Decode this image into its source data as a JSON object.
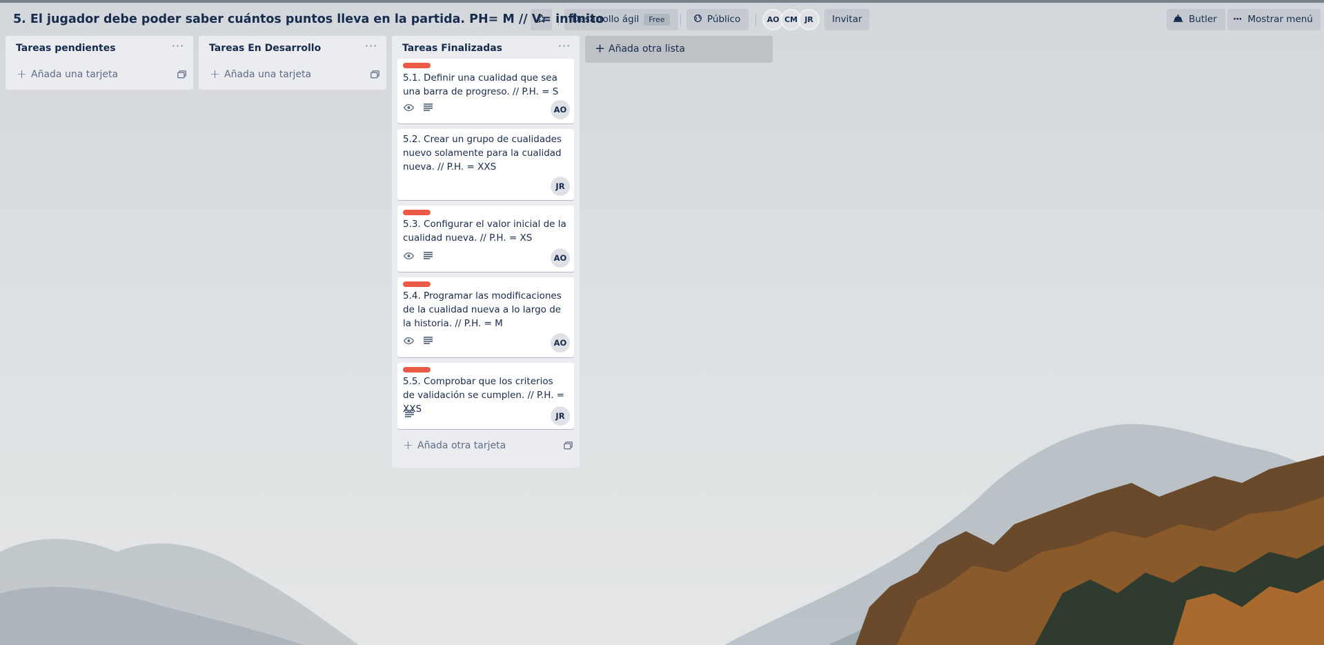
{
  "board": {
    "title": "5. El jugador debe poder saber cuántos puntos lleva en la partida. PH= M // V= infinito",
    "star_icon": "star-icon",
    "workspace": "Desarrollo ágil",
    "workspace_badge": "Free",
    "visibility": "Público",
    "visibility_icon": "globe-icon",
    "members": [
      "AO",
      "CM",
      "JR"
    ],
    "invite_label": "Invitar",
    "butler_label": "Butler",
    "butler_icon": "butler-icon",
    "menu_label": "Mostrar menú",
    "menu_icon": "ellipsis-icon"
  },
  "lists": [
    {
      "title": "Tareas pendientes",
      "add_card_label": "Añada una tarjeta",
      "cards": []
    },
    {
      "title": "Tareas En Desarrollo",
      "add_card_label": "Añada una tarjeta",
      "cards": []
    },
    {
      "title": "Tareas Finalizadas",
      "add_card_label": "Añada otra tarjeta",
      "cards": [
        {
          "title": "5.1. Definir una cualidad que sea una barra de progreso. // P.H. = S",
          "label_color": "#eb5a46",
          "badges": [
            "eye-icon",
            "description-icon"
          ],
          "member": "AO"
        },
        {
          "title": "5.2. Crear un grupo de cualidades nuevo solamente para la cualidad nueva. // P.H. = XXS",
          "label_color": "",
          "badges": [],
          "member": "JR"
        },
        {
          "title": "5.3. Configurar el valor inicial de la cualidad nueva. // P.H. = XS",
          "label_color": "#eb5a46",
          "badges": [
            "eye-icon",
            "description-icon"
          ],
          "member": "AO"
        },
        {
          "title": "5.4. Programar las modificaciones de la cualidad nueva a lo largo de la historia. // P.H. = M",
          "label_color": "#eb5a46",
          "badges": [
            "eye-icon",
            "description-icon"
          ],
          "member": "AO"
        },
        {
          "title": "5.5. Comprobar que los criterios de validación se cumplen. // P.H. = XXS",
          "label_color": "#eb5a46",
          "badges": [
            "description-icon"
          ],
          "member": "JR"
        }
      ]
    }
  ],
  "add_list_label": "Añada otra lista"
}
